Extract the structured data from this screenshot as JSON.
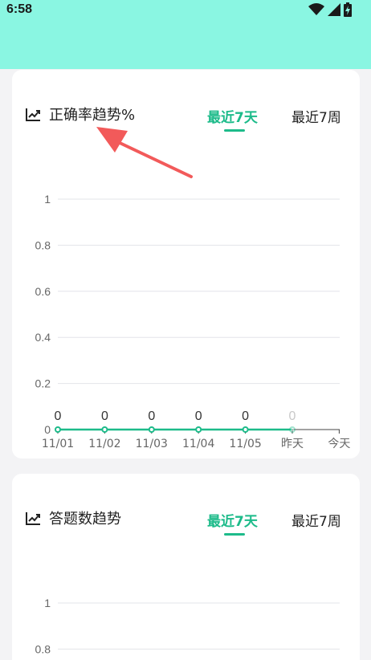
{
  "status_bar": {
    "time": "6:58",
    "icons": [
      "wifi-icon",
      "signal-icon",
      "battery-charging-icon"
    ]
  },
  "colors": {
    "header_bg": "#8af6e2",
    "accent": "#1dbb8a",
    "annotation_arrow": "#f25a5a"
  },
  "card_accuracy": {
    "title": "正确率趋势%",
    "tabs": [
      {
        "label": "最近7天",
        "active": true
      },
      {
        "label": "最近7周",
        "active": false
      }
    ]
  },
  "card_answers": {
    "title": "答题数趋势",
    "tabs": [
      {
        "label": "最近7天",
        "active": true
      },
      {
        "label": "最近7周",
        "active": false
      }
    ]
  },
  "chart_data": [
    {
      "type": "line",
      "categories": [
        "11/01",
        "11/02",
        "11/03",
        "11/04",
        "11/05",
        "昨天",
        "今天"
      ],
      "series": [
        {
          "values": [
            0,
            0,
            0,
            0,
            0,
            0,
            null
          ],
          "labels": [
            "0",
            "0",
            "0",
            "0",
            "0",
            "0",
            ""
          ]
        }
      ],
      "yticks": [
        "0",
        "0.2",
        "0.4",
        "0.6",
        "0.8",
        "1"
      ],
      "ylim": [
        0,
        1
      ],
      "grid": true
    },
    {
      "type": "line",
      "categories": [],
      "series": [],
      "yticks": [
        "0.8",
        "1"
      ],
      "ylim": [
        0,
        1
      ],
      "grid": true
    }
  ]
}
